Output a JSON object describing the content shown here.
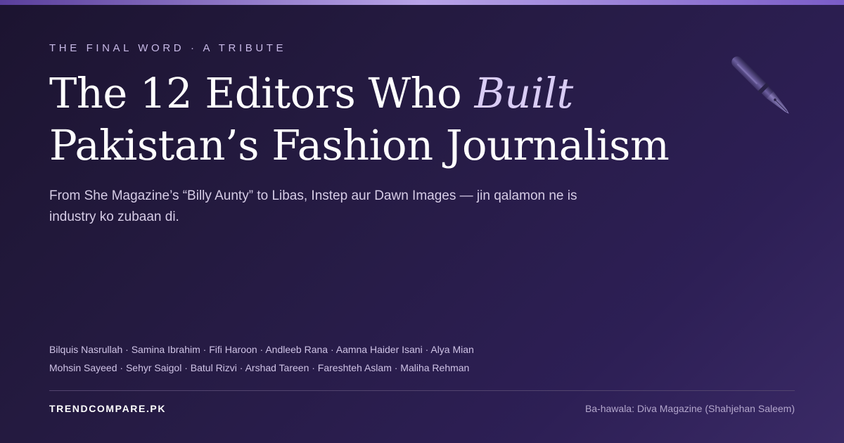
{
  "eyebrow": "THE FINAL WORD · A TRIBUTE",
  "headline": {
    "line1_before": "The 12 Editors Who ",
    "line1_accent": "Built",
    "line2": "Pakistan’s Fashion Journalism"
  },
  "subtitle": "From She Magazine’s “Billy Aunty” to Libas, Instep aur Dawn Images — jin qalamon ne is industry ko zubaan di.",
  "names": {
    "row1": "Bilquis Nasrullah · Samina Ibrahim · Fifi Haroon · Andleeb Rana · Aamna Haider Isani · Alya Mian",
    "row2": "Mohsin Sayeed · Sehyr Saigol · Batul Rizvi · Arshad Tareen · Fareshteh Aslam · Maliha Rehman"
  },
  "footer": {
    "brand": "TRENDCOMPARE.PK",
    "source": "Ba-hawala: Diva Magazine (Shahjehan Saleem)"
  },
  "icons": {
    "pen": "fountain-pen-icon"
  },
  "colors": {
    "background_start": "#1c1430",
    "background_end": "#3a2a66",
    "accent": "#d9ccf5",
    "top_bar": "#b8a4e8"
  }
}
